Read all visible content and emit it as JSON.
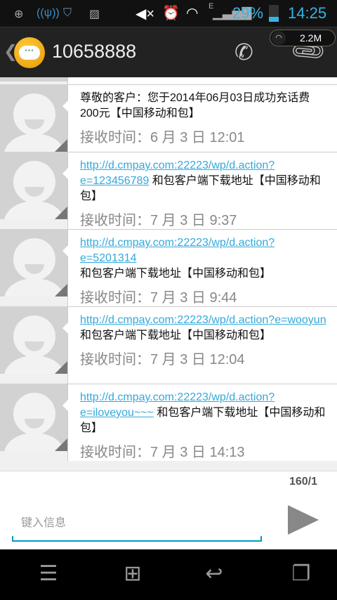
{
  "status_bar": {
    "battery_percent": "29%",
    "battery_level": 0.29,
    "time": "14:25",
    "network_type": "E",
    "icons": [
      "notification-add-icon",
      "usb-tether-icon",
      "shield-m-icon",
      "image-icon",
      "mute-icon",
      "alarm-icon",
      "wifi-icon",
      "signal-icon",
      "battery-icon"
    ]
  },
  "speed_widget": {
    "value": "2.2M"
  },
  "header": {
    "title": "10658888",
    "actions": [
      "phone-icon",
      "paperclip-icon"
    ]
  },
  "messages": [
    {
      "link": "",
      "text": "尊敬的客户：您于2014年06月03日成功充话费200元【中国移动和包】",
      "time": "接收时间：6 月 3 日 12:01"
    },
    {
      "link": "http://d.cmpay.com:22223/wp/d.action?e=123456789",
      "text": " 和包客户端下载地址【中国移动和包】",
      "time": "接收时间：7 月 3 日 9:37"
    },
    {
      "link": "http://d.cmpay.com:22223/wp/d.action?e=5201314",
      "text": " 和包客户端下载地址【中国移动和包】",
      "time": "接收时间：7 月 3 日 9:44"
    },
    {
      "link": "http://d.cmpay.com:22223/wp/d.action?e=wooyun",
      "text": " 和包客户端下载地址【中国移动和包】",
      "time": "接收时间：7 月 3 日 12:04"
    },
    {
      "link": "http://d.cmpay.com:22223/wp/d.action?e=iloveyou~~~",
      "text": " 和包客户端下载地址【中国移动和包】",
      "time": "接收时间：7 月 3 日 14:13"
    }
  ],
  "compose": {
    "counter": "160/1",
    "placeholder": "键入信息",
    "value": ""
  },
  "accent_color": "#33b5e5"
}
